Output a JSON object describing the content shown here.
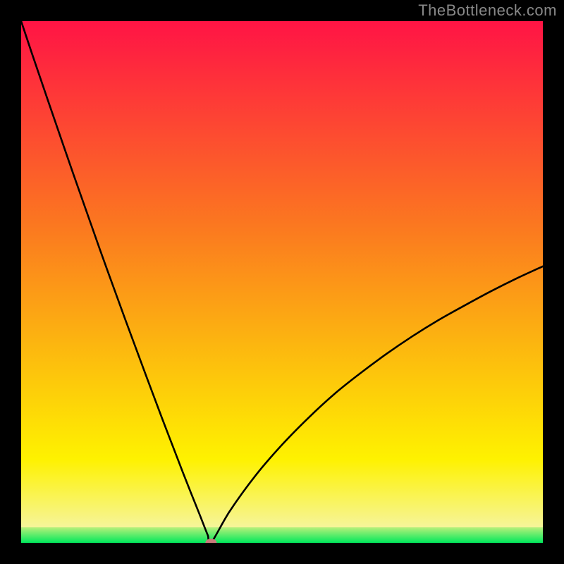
{
  "watermark": "TheBottleneck.com",
  "chart_data": {
    "type": "line",
    "title": "",
    "xlabel": "",
    "ylabel": "",
    "xlim": [
      0,
      100
    ],
    "ylim": [
      0,
      100
    ],
    "gradient_bands": [
      {
        "name": "green",
        "y_from": 0,
        "y_to": 3,
        "color_bottom": "#00e85c",
        "color_top": "#b8f07a"
      },
      {
        "name": "yellow",
        "y_from": 3,
        "y_to": 16,
        "color_bottom": "#f6f59a",
        "color_top": "#fef200"
      },
      {
        "name": "orange",
        "y_from": 16,
        "y_to": 60,
        "color_bottom": "#fef200",
        "color_top": "#fb7a1f"
      },
      {
        "name": "red",
        "y_from": 60,
        "y_to": 100,
        "color_bottom": "#fb7a1f",
        "color_top": "#ff1445"
      }
    ],
    "series": [
      {
        "name": "curve",
        "x": [
          0,
          2,
          5,
          10,
          15,
          20,
          24,
          27,
          29,
          31,
          32.5,
          33.7,
          34.5,
          35.2,
          35.8,
          36.4,
          40,
          45,
          50,
          55,
          60,
          65,
          70,
          75,
          80,
          85,
          90,
          95,
          100
        ],
        "y": [
          100,
          94,
          85.2,
          70.7,
          56.5,
          42.7,
          31.9,
          23.9,
          18.7,
          13.5,
          9.7,
          6.7,
          4.7,
          2.9,
          1.4,
          0,
          6.1,
          13,
          18.8,
          23.9,
          28.5,
          32.5,
          36.2,
          39.6,
          42.7,
          45.5,
          48.2,
          50.7,
          53
        ]
      }
    ],
    "marker": {
      "x": 36.4,
      "y": 0,
      "color": "#c97b7b",
      "rx": 8,
      "ry": 6
    }
  }
}
